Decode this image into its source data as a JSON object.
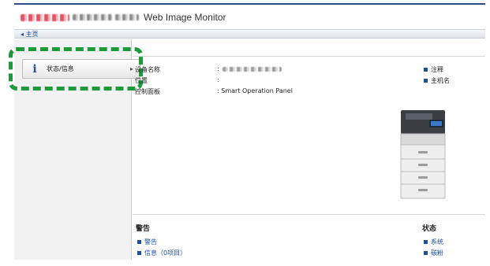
{
  "header": {
    "title": "Web Image Monitor"
  },
  "nav": {
    "home": "◂ 主页"
  },
  "sidebar": {
    "items": [
      {
        "label": "状态/信息",
        "icon": "info-icon",
        "chevron": "▸"
      }
    ]
  },
  "device_info": {
    "rows": [
      {
        "label": "设备名称",
        "value": ""
      },
      {
        "label": "位置",
        "value": ""
      },
      {
        "label": "控制面板",
        "value": "Smart Operation Panel"
      }
    ],
    "colon": ":"
  },
  "right_links": [
    "注释",
    "主机名"
  ],
  "bottom": {
    "alerts_title": "警告",
    "alerts_links": [
      "警告",
      "信息（0项目）"
    ],
    "status_title": "状态",
    "status_links": [
      "系统",
      "碳粉"
    ]
  },
  "colors": {
    "accent": "#1e4f9a",
    "highlight": "#1e9a3a",
    "topline": "#2f4a8a"
  }
}
